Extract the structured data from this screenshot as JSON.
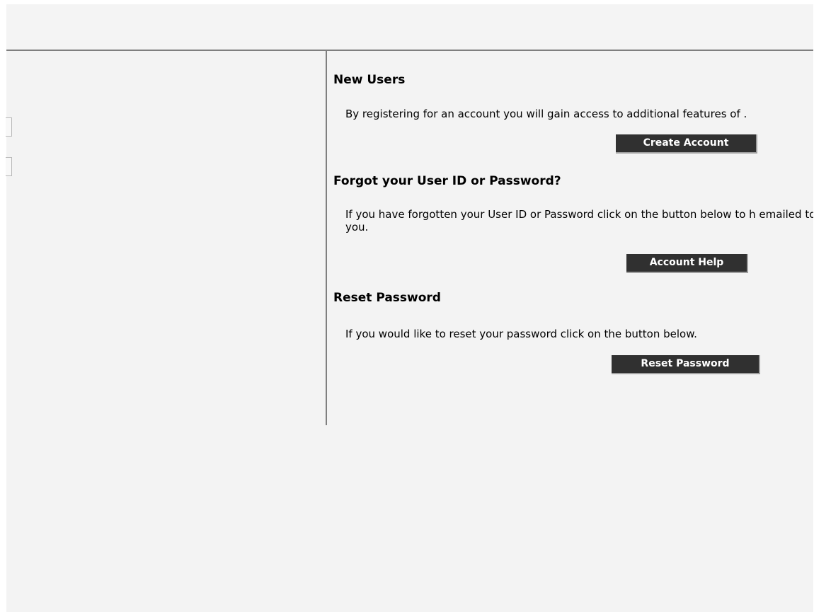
{
  "sections": {
    "new_users": {
      "title": "New Users",
      "text": "By registering for an account you will gain access to additional features of .",
      "button_label": "Create Account"
    },
    "forgot": {
      "title": "Forgot your User ID or Password?",
      "text": "If you have forgotten your User ID or Password click on the button below to h emailed to you.",
      "button_label": "Account Help"
    },
    "reset": {
      "title": "Reset Password",
      "text": "If you would like to reset your password click on the button below.",
      "button_label": "Reset Password"
    }
  },
  "colors": {
    "page_background": "#f3f3f3",
    "divider": "#7f7f7f",
    "button_background": "#303030",
    "button_text": "#ffffff"
  }
}
